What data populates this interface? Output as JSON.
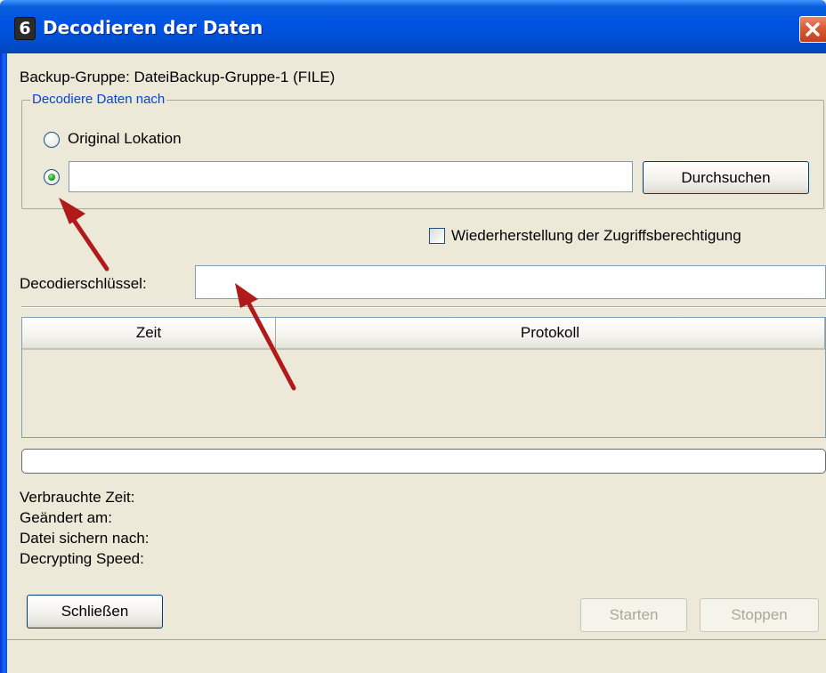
{
  "window": {
    "title": "Decodieren der Daten",
    "app_icon_glyph": "6"
  },
  "backup_group_label": "Backup-Gruppe: DateiBackup-Gruppe-1 (FILE)",
  "decode_group": {
    "legend": "Decodiere Daten nach",
    "option_original": {
      "label": "Original Lokation",
      "selected": false
    },
    "option_custom": {
      "selected": true,
      "path_value": ""
    },
    "browse_button": "Durchsuchen"
  },
  "restore_permissions": {
    "label": "Wiederherstellung der Zugriffsberechtigung",
    "checked": false
  },
  "decode_key": {
    "label": "Decodierschlüssel:",
    "value": ""
  },
  "log_table": {
    "columns": [
      "Zeit",
      "Protokoll"
    ],
    "rows": []
  },
  "progress": {
    "value": 0
  },
  "info": {
    "elapsed_label": "Verbrauchte Zeit:",
    "modified_label": "Geändert am:",
    "save_to_label": "Datei sichern nach:",
    "speed_label": "Decrypting Speed:"
  },
  "buttons": {
    "close": "Schließen",
    "start": "Starten",
    "stop": "Stoppen"
  },
  "colors": {
    "legend": "#0046d5",
    "arrow": "#b01a1a",
    "titlebar": "#0054e3"
  },
  "icons": [
    "app-icon",
    "close-icon",
    "radio-selected-icon",
    "annotation-arrow-icon"
  ]
}
